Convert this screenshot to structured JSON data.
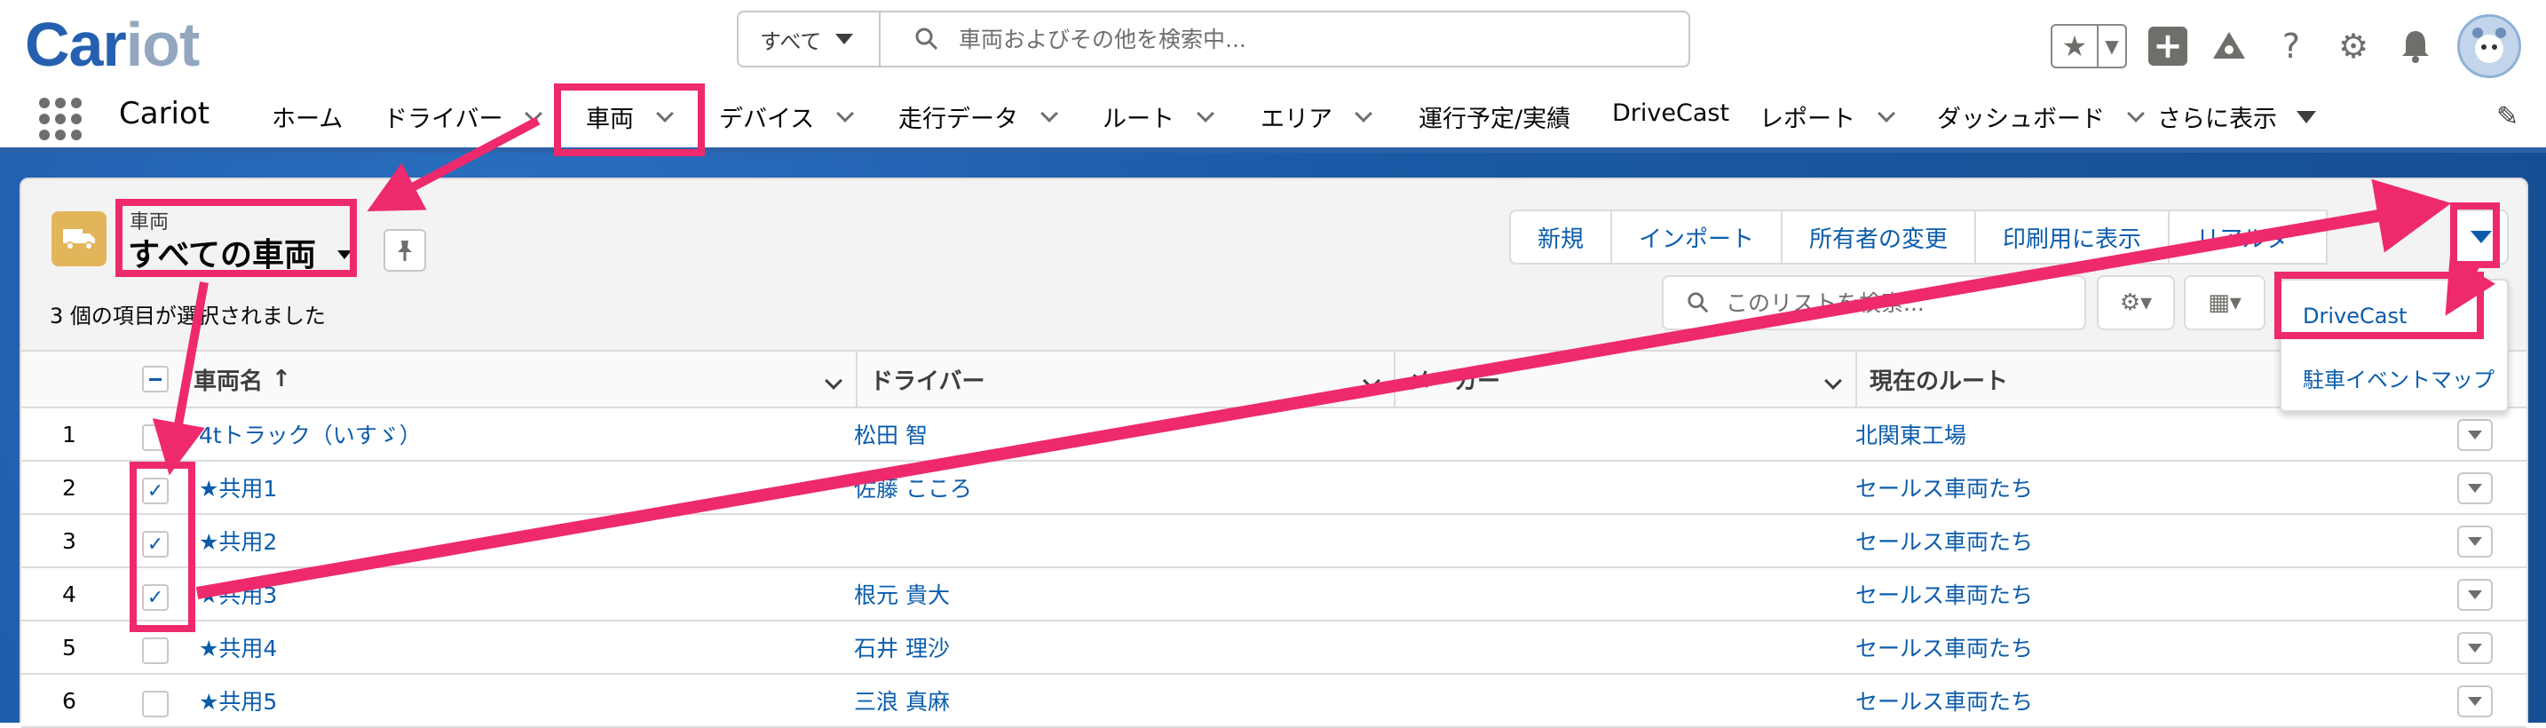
{
  "brand": {
    "logo_primary": "Car",
    "logo_secondary": "iot",
    "primary_color": "#2560b0",
    "accent_color": "#ee2a6c"
  },
  "header": {
    "search_scope": "すべて",
    "search_placeholder": "車両およびその他を検索中...",
    "icons": [
      "star-icon",
      "plus-icon",
      "trailhead-icon",
      "help-icon",
      "gear-icon",
      "bell-icon",
      "avatar"
    ]
  },
  "nav": {
    "app_name": "Cariot",
    "items": [
      {
        "label": "ホーム"
      },
      {
        "label": "ドライバー"
      },
      {
        "label": "車両"
      },
      {
        "label": "デバイス"
      },
      {
        "label": "走行データ"
      },
      {
        "label": "ルート"
      },
      {
        "label": "エリア"
      },
      {
        "label": "運行予定/実績"
      },
      {
        "label": "DriveCast"
      },
      {
        "label": "レポート"
      },
      {
        "label": "ダッシュボード"
      },
      {
        "label": "さらに表示"
      }
    ]
  },
  "list_view": {
    "object_label": "車両",
    "title": "すべての車両",
    "selected_count_text": "3 個の項目が選択されました",
    "actions": [
      "新規",
      "インポート",
      "所有者の変更",
      "印刷用に表示",
      "リアルタ"
    ],
    "search_placeholder": "このリストを検索...",
    "dropdown_items": [
      "DriveCast",
      "駐車イベントマップ"
    ]
  },
  "table": {
    "columns": [
      "車両名",
      "ドライバー",
      "メーカー",
      "現在のルート"
    ],
    "rows": [
      {
        "num": "1",
        "checked": false,
        "name": "4tトラック（いすゞ）",
        "driver": "松田 智",
        "route": "北関東工場"
      },
      {
        "num": "2",
        "checked": true,
        "name": "★共用1",
        "driver": "佐藤 こころ",
        "route": "セールス車両たち"
      },
      {
        "num": "3",
        "checked": true,
        "name": "★共用2",
        "driver": "",
        "route": "セールス車両たち"
      },
      {
        "num": "4",
        "checked": true,
        "name": "★共用3",
        "driver": "根元 貴大",
        "route": "セールス車両たち"
      },
      {
        "num": "5",
        "checked": false,
        "name": "★共用4",
        "driver": "石井 理沙",
        "route": "セールス車両たち"
      },
      {
        "num": "6",
        "checked": false,
        "name": "★共用5",
        "driver": "三浪 真麻",
        "route": "セールス車両たち"
      }
    ]
  }
}
